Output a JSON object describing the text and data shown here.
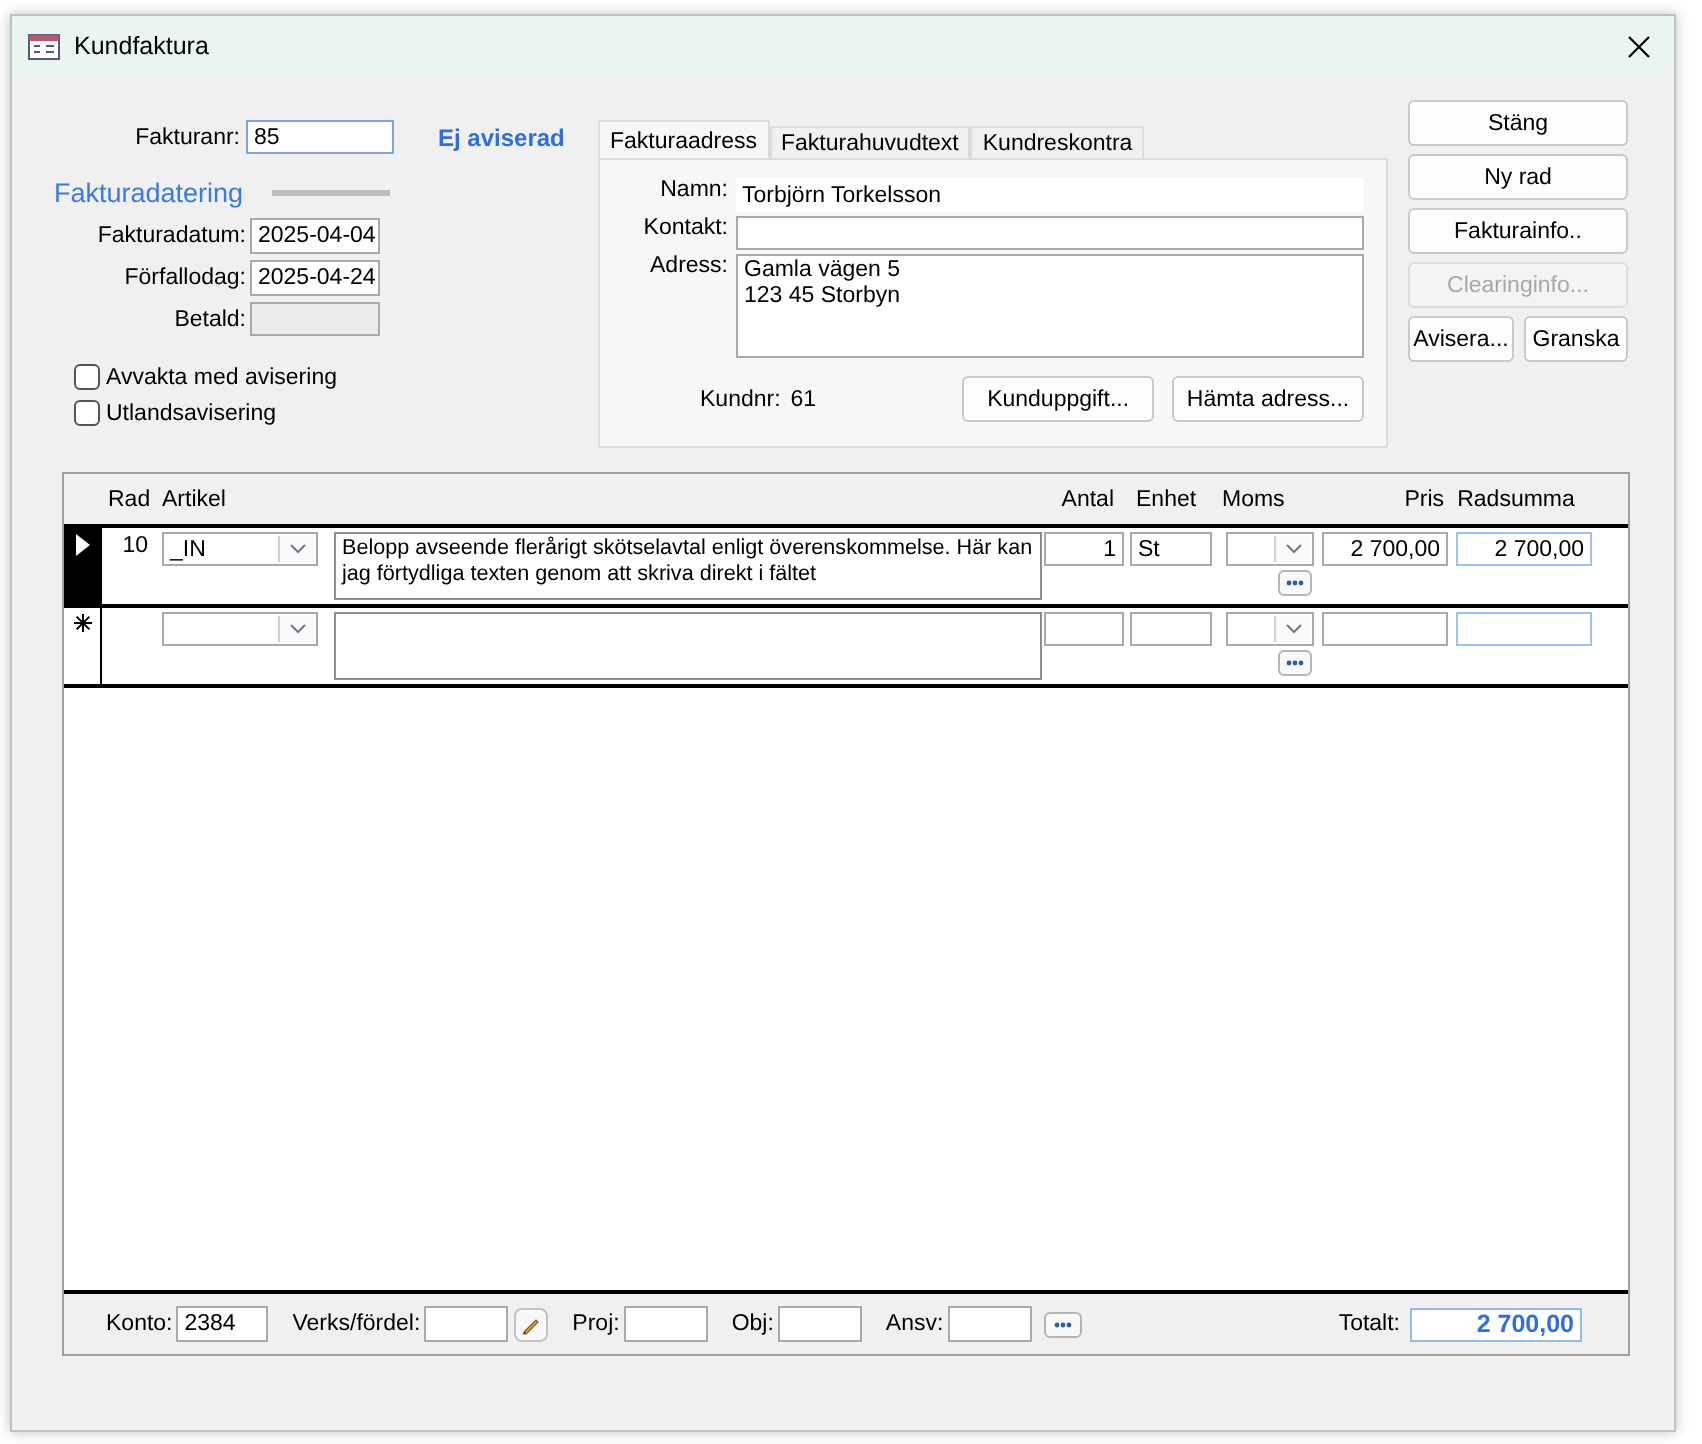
{
  "window": {
    "title": "Kundfaktura"
  },
  "invoice": {
    "number_label": "Fakturanr:",
    "number": "85",
    "status": "Ej aviserad"
  },
  "dating": {
    "heading": "Fakturadatering",
    "fields": [
      {
        "label": "Fakturadatum:",
        "value": "2025-04-04",
        "disabled": false
      },
      {
        "label": "Förfallodag:",
        "value": "2025-04-24",
        "disabled": false
      },
      {
        "label": "Betald:",
        "disabled": true
      }
    ]
  },
  "options": [
    {
      "label": "Avvakta med avisering",
      "checked": false
    },
    {
      "label": "Utlandsavisering",
      "checked": false
    }
  ],
  "tabs": [
    {
      "label": "Fakturaadress",
      "selected": true
    },
    {
      "label": "Fakturahuvudtext",
      "selected": false
    },
    {
      "label": "Kundreskontra",
      "selected": false
    }
  ],
  "address": {
    "fields": [
      {
        "label": "Namn:",
        "value": "Torbjörn Torkelsson",
        "kind": "plain"
      },
      {
        "label": "Kontakt:",
        "kind": "line"
      },
      {
        "label": "Adress:",
        "value": "Gamla vägen 5\n123 45 Storbyn",
        "kind": "multiline"
      }
    ],
    "customer_label": "Kundnr:",
    "customer_no": "61",
    "buttons": [
      "Kunduppgift...",
      "Hämta adress..."
    ]
  },
  "actions": [
    {
      "label": "Stäng",
      "disabled": false,
      "kind": "full"
    },
    {
      "label": "Ny rad",
      "disabled": false,
      "kind": "full"
    },
    {
      "label": "Fakturainfo..",
      "disabled": false,
      "kind": "full"
    },
    {
      "label": "Clearinginfo...",
      "disabled": true,
      "kind": "full"
    },
    {
      "label": "Avisera...",
      "disabled": false,
      "kind": "half"
    },
    {
      "label": "Granska",
      "disabled": false,
      "kind": "half"
    }
  ],
  "table": {
    "columns": [
      "Rad",
      "Artikel",
      "Antal",
      "Enhet",
      "Moms",
      "Pris",
      "Radsumma"
    ],
    "rows": [
      {
        "kind": "record",
        "selected": true,
        "rad": "10",
        "artikel": "_IN",
        "text": "Belopp avseende flerårigt skötselavtal enligt överenskommelse. Här kan jag förtydliga texten genom att skriva direkt i fältet",
        "antal": "1",
        "enhet": "St",
        "pris": "2 700,00",
        "radsumma": "2 700,00"
      },
      {
        "kind": "new",
        "selected": false
      }
    ]
  },
  "footer": {
    "fields": [
      {
        "label": "Konto:",
        "value": "2384",
        "kind": "plain"
      },
      {
        "label": "Verks/fördel:",
        "kind": "edit"
      },
      {
        "label": "Proj:",
        "kind": "plain"
      },
      {
        "label": "Obj:",
        "kind": "plain"
      },
      {
        "label": "Ansv:",
        "kind": "more"
      }
    ],
    "total_label": "Totalt:",
    "total": "2 700,00"
  }
}
